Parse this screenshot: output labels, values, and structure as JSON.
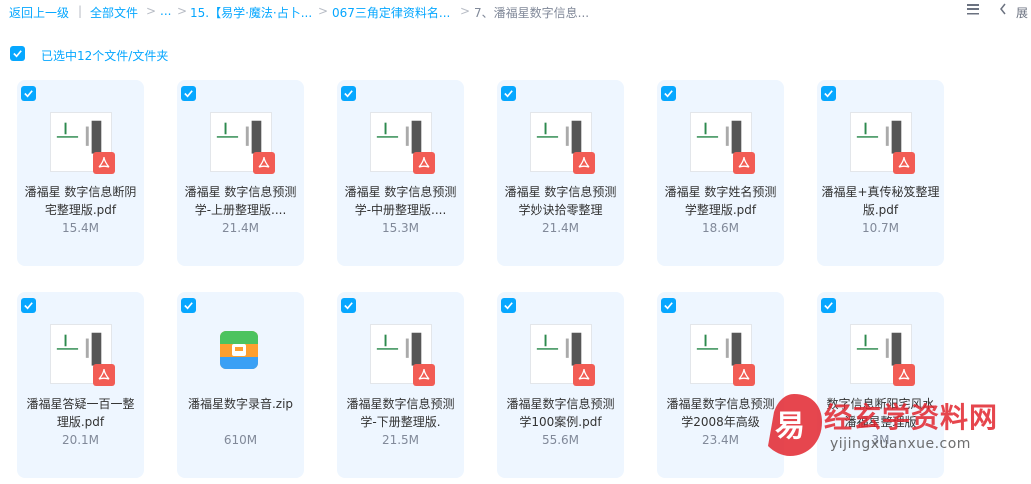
{
  "breadcrumb": {
    "back": "返回上一级",
    "divider": "|",
    "all_files": "全部文件",
    "ellipsis": "...",
    "level1": "15.【易学·魔法·占卜...",
    "level2": "067三角定律资料名...",
    "current": "7、潘福星数字信息...",
    "chevron": ">"
  },
  "toolbar": {
    "list_icon": "list-view-icon",
    "collapse_icon": "chevron-left-icon",
    "expand_label": "展"
  },
  "selection": {
    "text": "已选中12个文件/文件夹"
  },
  "files": [
    {
      "name": "潘福星 数字信息断阴宅整理版.pdf",
      "size": "15.4M",
      "type": "pdf",
      "selected": true
    },
    {
      "name": "潘福星 数字信息预测学-上册整理版....",
      "size": "21.4M",
      "type": "pdf",
      "selected": true
    },
    {
      "name": "潘福星 数字信息预测学-中册整理版....",
      "size": "15.3M",
      "type": "pdf",
      "selected": true
    },
    {
      "name": "潘福星 数字信息预测学妙诀拾零整理",
      "size": "21.4M",
      "type": "pdf",
      "selected": true
    },
    {
      "name": "潘福星 数字姓名预测学整理版.pdf",
      "size": "18.6M",
      "type": "pdf",
      "selected": true
    },
    {
      "name": "潘福星+真传秘笈整理版.pdf",
      "size": "10.7M",
      "type": "pdf",
      "selected": true
    },
    {
      "name": "潘福星答疑一百一整理版.pdf",
      "size": "20.1M",
      "type": "pdf",
      "selected": true
    },
    {
      "name": "潘福星数字录音.zip",
      "size": "610M",
      "type": "zip",
      "selected": true
    },
    {
      "name": "潘福星数字信息预测学-下册整理版.",
      "size": "21.5M",
      "type": "pdf",
      "selected": true
    },
    {
      "name": "潘福星数字信息预测学100案例.pdf",
      "size": "55.6M",
      "type": "pdf",
      "selected": true
    },
    {
      "name": "潘福星数字信息预测学2008年高级",
      "size": "23.4M",
      "type": "pdf",
      "selected": true
    },
    {
      "name": "数字信息断阳宅风水潘福星整理版",
      "size": "3M",
      "type": "pdf",
      "selected": true
    }
  ],
  "watermark": {
    "title": "经玄学资料网",
    "url": "yijingxuanxue.com"
  },
  "colors": {
    "accent": "#06a7ff",
    "card_bg": "#eef6ff",
    "pdf_red": "#f25c54",
    "watermark_red": "#e2262f"
  }
}
